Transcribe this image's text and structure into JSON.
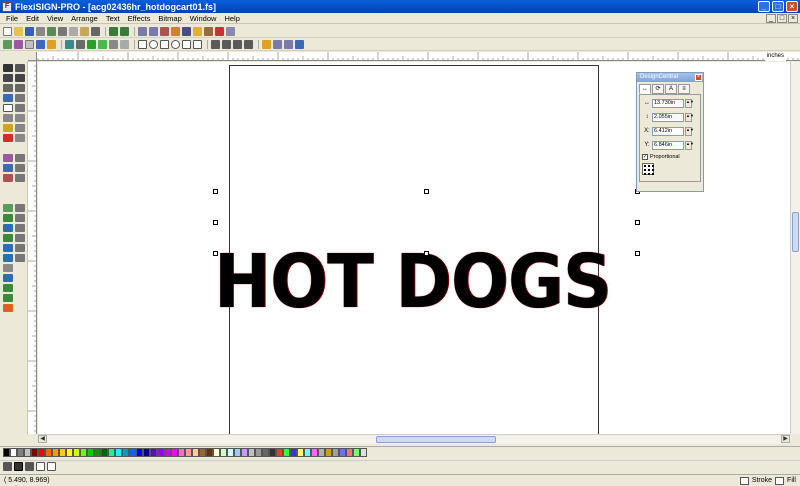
{
  "window": {
    "title": "FlexiSIGN-PRO - [acg02436hr_hotdogcart01.fs]",
    "app_icon_glyph": "F"
  },
  "menu": [
    "File",
    "Edit",
    "View",
    "Arrange",
    "Text",
    "Effects",
    "Bitmap",
    "Window",
    "Help"
  ],
  "window_buttons": {
    "minimize": "_",
    "maximize": "□",
    "close": "×"
  },
  "ruler": {
    "units": "inches"
  },
  "canvas": {
    "sign_text": "HOT DOGS"
  },
  "design_central": {
    "title": "DesignCentral",
    "tabs": [
      "↔",
      "⟳",
      "A",
      "≡"
    ],
    "fields": [
      {
        "icon": "↔",
        "value": "13.730in"
      },
      {
        "icon": "↕",
        "value": "2.055in"
      },
      {
        "icon": "X:",
        "value": "6.412in"
      },
      {
        "icon": "Y:",
        "value": "6.846in"
      }
    ],
    "proportional": {
      "label": "Proportional",
      "checked": true
    }
  },
  "status": {
    "coords": "(    5.490,    8.969)",
    "stroke_label": "Stroke",
    "fill_label": "Fill"
  },
  "palette": [
    "#000000",
    "#ffffff",
    "#808080",
    "#c0c0c0",
    "#800000",
    "#ff0000",
    "#ff6600",
    "#ff9900",
    "#ffcc00",
    "#ffff00",
    "#ccff00",
    "#66ff00",
    "#00cc00",
    "#009900",
    "#006600",
    "#00ff99",
    "#00ffff",
    "#0099cc",
    "#0066ff",
    "#0000ff",
    "#000099",
    "#6600cc",
    "#9900ff",
    "#cc00ff",
    "#ff00ff",
    "#ff66cc",
    "#ff9999",
    "#ffcc99",
    "#996633",
    "#663300",
    "#ffffcc",
    "#ccffcc",
    "#ccffff",
    "#99ccff",
    "#cc99ff",
    "#c0c0c0",
    "#999999",
    "#666666",
    "#333333",
    "#ff3333",
    "#33ff33",
    "#3333ff",
    "#ffff66",
    "#66ffff",
    "#ff66ff",
    "#b0b0b0",
    "#d4a000",
    "#a0a0a0",
    "#7070ff",
    "#ff7070",
    "#70ff70",
    "#e0e0e0"
  ]
}
